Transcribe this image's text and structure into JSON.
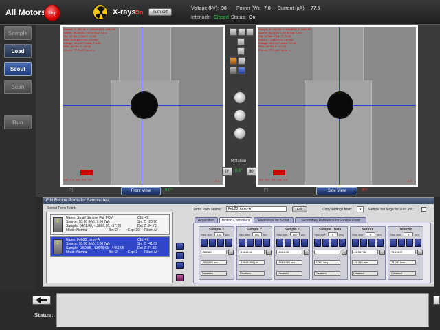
{
  "header": {
    "all_motors": "All Motors:",
    "stop": "Stop",
    "xrays_label": "X-rays:",
    "xrays_state": "On",
    "turn_off": "Turn Off",
    "voltage_label": "Voltage (kV):",
    "voltage_value": "90",
    "power_label": "Power (W):",
    "power_value": "7.0",
    "current_label": "Current (µA):",
    "current_value": "77.5",
    "interlock_label": "Interlock:",
    "interlock_value": "Closed",
    "status_label": "Status:",
    "status_value": "On",
    "colors": {
      "closed": "#2ecc40",
      "on": "#e33",
      "stop": "#d40000"
    }
  },
  "sidebar": {
    "items": [
      {
        "label": "Sample",
        "state": "disabled"
      },
      {
        "label": "Load",
        "state": "enabled"
      },
      {
        "label": "Scout",
        "state": "active"
      },
      {
        "label": "Scan",
        "state": "disabled"
      },
      {
        "label": "Run",
        "state": "disabled"
      }
    ]
  },
  "views": {
    "front_label": "Front View",
    "front_angle": "0.0°",
    "side_label": "Side View",
    "side_angle": "90°",
    "rotation_label": "Rotation",
    "rot_left": "0°",
    "rot_mid": "0.0°",
    "rot_right": "90°",
    "left_scale": "0.3",
    "right_scale": "0.3"
  },
  "edit_panel": {
    "title": "Edit Recipe Points for Sample: test",
    "select_label": "Select Tomo Point:",
    "tomo_point_name_label": "Tomo Point Name:",
    "tomo_point_name_value": "Feb20_tomo-A",
    "edit_btn": "Edit",
    "copy_settings_label": "Copy settings from:",
    "sample_too_large": "Sample too large for auto. ref.:",
    "points": [
      {
        "num": "1",
        "name": "Name: Small Sample Full FOV",
        "source": "Source: 90.00 (kV),  7.00 (W)",
        "sample": "Sample: 5401.00, -13686.90, -57.20",
        "mode": "Mode: Normal",
        "obj": "Obj: 4X",
        "src_z": "Src Z: -20.90",
        "det_z": "Det Z: 94.78",
        "bin": "Bin: 2",
        "exp": "Exp: 10",
        "filter": "Filter: Air"
      },
      {
        "num": "2",
        "name": "Name: Feb20_tomo-A",
        "source": "Source: 90.00 (kV),  7.00 (W)",
        "sample": "Sample: -352.85, -13648.65, -4461.95",
        "mode": "Mode: Normal",
        "obj": "Obj: 4X",
        "src_z": "Src Z: -41.02",
        "det_z": "Det Z: 74.30",
        "bin": "Bin: 2",
        "exp": "Exp: 1",
        "filter": "Filter: Air"
      }
    ],
    "tabs": [
      "Acquisition",
      "Motion Controllers",
      "Reference for Scout",
      "Secondary Reference for Recipe Point"
    ],
    "active_tab": 1,
    "motors": [
      {
        "title": "Sample X",
        "step": "100",
        "unit": "µm",
        "value": "-352.85",
        "readout": "-353.650 µm",
        "state": "Disabled"
      },
      {
        "title": "Sample Y",
        "step": "100",
        "unit": "µm",
        "value": "-13648.65",
        "readout": "-13648.650 µm",
        "state": "Disabled"
      },
      {
        "title": "Sample Z",
        "step": "100",
        "unit": "µm",
        "value": "-4461.95",
        "readout": "-4461.950 µm",
        "state": "Disabled"
      },
      {
        "title": "Sample Theta",
        "step": "5",
        "unit": "deg",
        "value": "",
        "readout": "0.003 deg",
        "state": "Disabled"
      },
      {
        "title": "Source",
        "step": "5",
        "unit": "mm",
        "value": "-41.01778",
        "readout": "-41.018 mm",
        "state": "Disabled"
      },
      {
        "title": "Detector",
        "step": "5",
        "unit": "mm",
        "value": "74.29697",
        "readout": "74.297 mm",
        "state": "Disabled"
      }
    ]
  },
  "footer": {
    "status_label": "Status:"
  }
}
